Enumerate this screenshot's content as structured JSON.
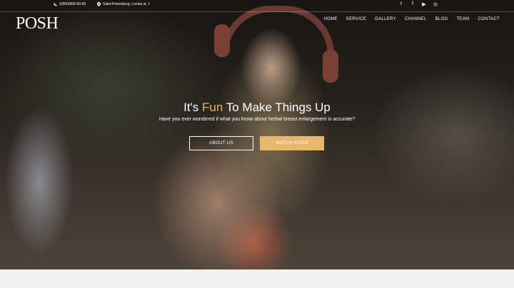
{
  "colors": {
    "accent": "#e8b865",
    "button_fill": "#e6b76c",
    "text": "#ffffff"
  },
  "topbar": {
    "phone": "3(900)900-90-90",
    "address": "Saint-Petersburg, Lenina st, 1"
  },
  "social": [
    {
      "icon": "twitter-icon",
      "glyph": "t"
    },
    {
      "icon": "facebook-icon",
      "glyph": "f"
    },
    {
      "icon": "youtube-icon",
      "glyph": "▶"
    },
    {
      "icon": "instagram-icon",
      "glyph": "◎"
    }
  ],
  "logo": "POSH",
  "nav": [
    "HOME",
    "SERVICE",
    "GALLERY",
    "CHANNEL",
    "BLOG",
    "TEAM",
    "CONTACT"
  ],
  "hero": {
    "headline_pre": "It's ",
    "headline_accent": "Fun",
    "headline_post": " To Make Things Up",
    "subtitle": "Have you ever wondered if what you know about herbal breast enlargement is accurate?",
    "btn_about": "ABOUT US",
    "btn_video": "WATCH VIDEO"
  }
}
